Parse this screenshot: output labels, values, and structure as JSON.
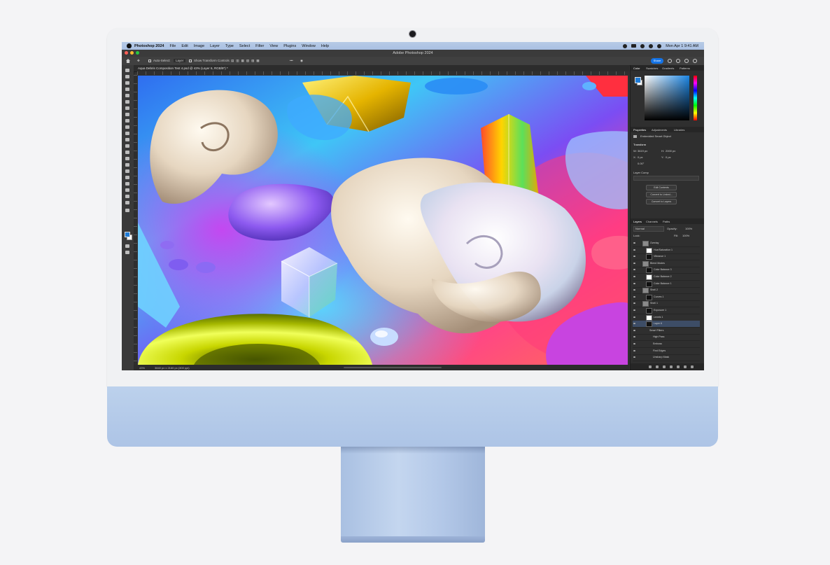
{
  "menubar": {
    "app_name": "Photoshop 2024",
    "items": [
      "File",
      "Edit",
      "Image",
      "Layer",
      "Type",
      "Select",
      "Filter",
      "View",
      "Plugins",
      "Window",
      "Help"
    ],
    "clock": "Mon Apr 1  9:41 AM"
  },
  "window": {
    "title": "Adobe Photoshop 2024"
  },
  "options_bar": {
    "auto_select_label": "Auto-Select:",
    "target_value": "Layer",
    "show_transform_label": "Show Transform Controls",
    "share_label": "Share"
  },
  "document": {
    "tab_label": "Aqua Debris Composition Test 4.psd @ 43% (Layer 6, RGB/8*) *",
    "zoom": "43%",
    "doc_info": "3840 px x 2160 px (300 ppi)"
  },
  "color_panel": {
    "tabs": [
      "Color",
      "Swatches",
      "Gradients",
      "Patterns"
    ]
  },
  "properties_panel": {
    "tabs": [
      "Properties",
      "Adjustments",
      "Libraries"
    ],
    "object_type": "Embedded Smart Object",
    "transform_label": "Transform",
    "w_value": "3619 px",
    "h_value": "2000 px",
    "x_value": "0 px",
    "y_value": "0 px",
    "angle_value": "0.00°",
    "layer_comp_label": "Layer Comp",
    "buttons": [
      "Edit Contents",
      "Convert to Linked...",
      "Convert to Layers"
    ]
  },
  "layers_panel": {
    "tabs": [
      "Layers",
      "Channels",
      "Paths"
    ],
    "blend_mode": "Normal",
    "opacity_label": "Opacity:",
    "opacity_value": "100%",
    "lock_label": "Lock:",
    "fill_label": "Fill:",
    "fill_value": "100%",
    "layers": [
      {
        "name": "Overlay",
        "indent": 0,
        "group": true
      },
      {
        "name": "Hue/Saturation 1",
        "indent": 1
      },
      {
        "name": "Vibrance 1",
        "indent": 1
      },
      {
        "name": "Blend Modes",
        "indent": 0,
        "group": true
      },
      {
        "name": "Color Balance 3",
        "indent": 1
      },
      {
        "name": "Color Balance 2",
        "indent": 1
      },
      {
        "name": "Color Balance 1",
        "indent": 1
      },
      {
        "name": "Shell 2",
        "indent": 0,
        "group": true
      },
      {
        "name": "Curves 1",
        "indent": 1
      },
      {
        "name": "Shell 1",
        "indent": 0,
        "group": true
      },
      {
        "name": "Exposure 1",
        "indent": 1
      },
      {
        "name": "Levels 1",
        "indent": 1
      },
      {
        "name": "Layer 6",
        "indent": 1,
        "selected": true
      },
      {
        "name": "Smart Filters",
        "indent": 2
      },
      {
        "name": "High Pass",
        "indent": 3
      },
      {
        "name": "Emboss",
        "indent": 3
      },
      {
        "name": "Find Edges",
        "indent": 3
      },
      {
        "name": "Unsharp Mask",
        "indent": 3
      }
    ]
  },
  "colors": {
    "accent": "#1473e6",
    "imac_blue": "#b3c8e8",
    "panel_bg": "#2f2f2f"
  }
}
